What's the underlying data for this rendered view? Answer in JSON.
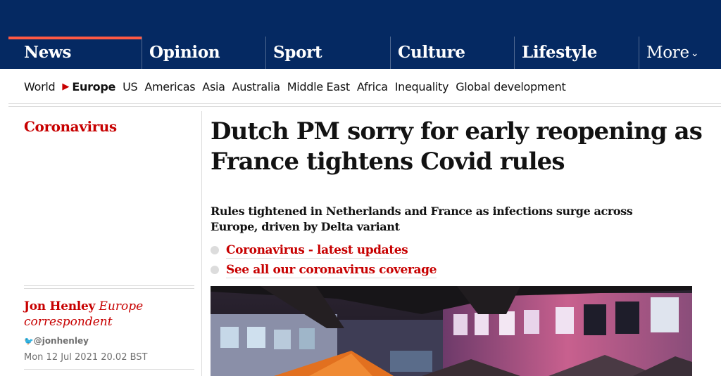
{
  "nav": {
    "pillars": [
      {
        "label": "News"
      },
      {
        "label": "Opinion"
      },
      {
        "label": "Sport"
      },
      {
        "label": "Culture"
      },
      {
        "label": "Lifestyle"
      },
      {
        "label": "More"
      }
    ]
  },
  "subnav": {
    "items": [
      "World",
      "Europe",
      "US",
      "Americas",
      "Asia",
      "Australia",
      "Middle East",
      "Africa",
      "Inequality",
      "Global development"
    ]
  },
  "article": {
    "section": "Coronavirus",
    "headline": "Dutch PM sorry for early reopening as France tightens Covid rules",
    "standfirst": "Rules tightened in Netherlands and France as infections surge across Europe, driven by Delta variant",
    "links": [
      "Coronavirus - latest updates",
      "See all our coronavirus coverage"
    ],
    "byline": {
      "author": "Jon Henley",
      "role": "Europe correspondent",
      "twitter": "@jonhenley",
      "date": "Mon 12 Jul 2021 20.02 BST"
    }
  },
  "colors": {
    "brand": "#052962",
    "news_accent": "#ff5943",
    "section_red": "#c70000"
  }
}
